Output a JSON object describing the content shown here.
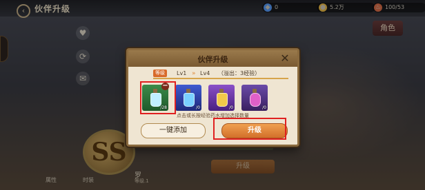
{
  "screen": {
    "title": "伙伴升级"
  },
  "resources": [
    {
      "icon": "crystal-icon",
      "value": "0",
      "color": "#5aa0ff"
    },
    {
      "icon": "coin-icon",
      "value": "5.2万",
      "color": "#f2c04a"
    },
    {
      "icon": "stamina-icon",
      "value": "100/53",
      "color": "#e0704a"
    }
  ],
  "sidebar": {
    "role_label": "角色"
  },
  "modal": {
    "title": "伙伴升级",
    "close_icon": "close-icon",
    "level_tag": "等级",
    "level_from": "Lv1",
    "level_to": "Lv4",
    "overflow": "（溢出：3经验）",
    "slots": [
      {
        "count": "/28",
        "color": "#3fb04a"
      },
      {
        "count": "/0",
        "color": "#3a5ad0"
      },
      {
        "count": "/0",
        "color": "#a060d0"
      },
      {
        "count": "/0",
        "color": "#d050c0"
      }
    ],
    "hint": "点击或长按经验药水增加选择数量",
    "add_label": "一键添加",
    "upgrade_label": "升级"
  },
  "character": {
    "name": "罗",
    "level": "等级.1",
    "rank": "SS"
  },
  "background_upgrade_label": "升级",
  "bottom": {
    "left": "属性",
    "right": "时装"
  }
}
